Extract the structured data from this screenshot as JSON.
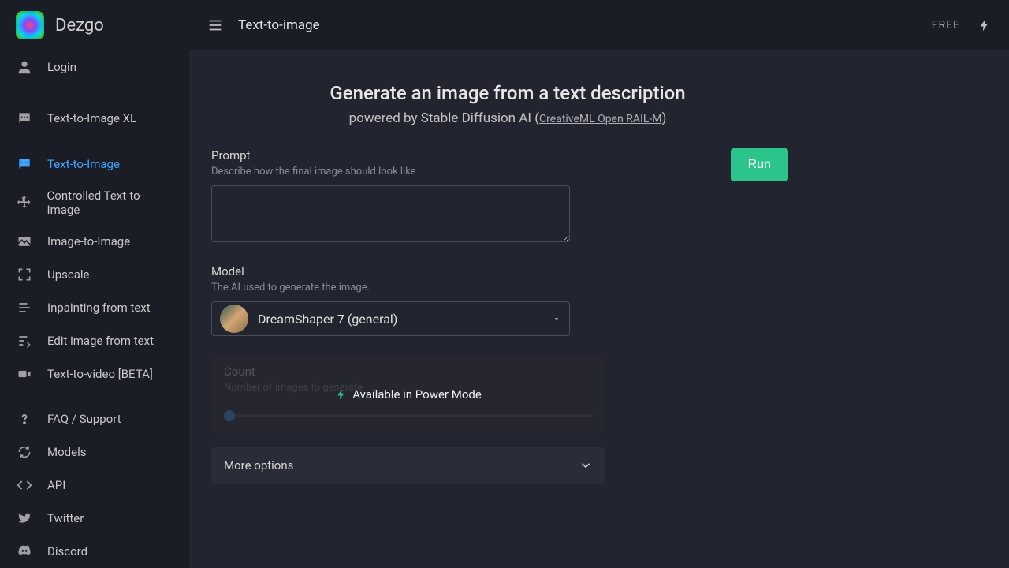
{
  "app": {
    "name": "Dezgo"
  },
  "sidebar": {
    "login": "Login",
    "items": [
      {
        "label": "Text-to-Image XL"
      },
      {
        "label": "Text-to-Image"
      },
      {
        "label": "Controlled Text-to-Image"
      },
      {
        "label": "Image-to-Image"
      },
      {
        "label": "Upscale"
      },
      {
        "label": "Inpainting from text"
      },
      {
        "label": "Edit image from text"
      },
      {
        "label": "Text-to-video [BETA]"
      }
    ],
    "footer": [
      {
        "label": "FAQ / Support"
      },
      {
        "label": "Models"
      },
      {
        "label": "API"
      },
      {
        "label": "Twitter"
      },
      {
        "label": "Discord"
      }
    ]
  },
  "topbar": {
    "title": "Text-to-image",
    "plan": "FREE"
  },
  "hero": {
    "title": "Generate an image from a text description",
    "subtitle_prefix": "powered by Stable Diffusion AI ",
    "license_open": "(",
    "license_link": "CreativeML Open RAIL-M",
    "license_close": ")"
  },
  "form": {
    "prompt_label": "Prompt",
    "prompt_desc": "Describe how the final image should look like",
    "model_label": "Model",
    "model_desc": "The AI used to generate the image.",
    "model_selected": "DreamShaper 7 (general)",
    "count_label": "Count",
    "count_desc": "Number of images to generate",
    "count_overlay": "Available in Power Mode",
    "more": "More options",
    "run": "Run"
  }
}
